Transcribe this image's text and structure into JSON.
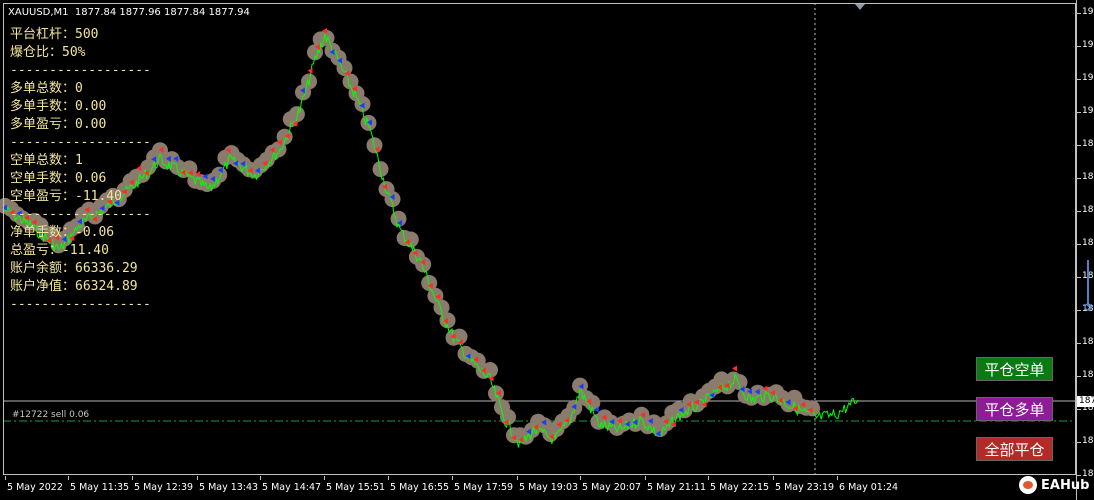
{
  "app": {
    "window_title": "XAUUSD,M1  1877.84 1877.96 1877.84 1877.94"
  },
  "info_panel": {
    "lines": [
      "平台杠杆：500",
      "爆仓比：50%",
      "------------------",
      "多单总数：0",
      "多单手数：0.00",
      "多单盈亏：0.00",
      "------------------",
      "空单总数：1",
      "空单手数：0.06",
      "空单盈亏：-11.40",
      "------------------",
      "净单手数：-0.06",
      "总盈亏：-11.40",
      "账户余额：66336.29",
      "账户净值：66324.89",
      "------------------"
    ]
  },
  "buttons": {
    "close_short": "平仓空单",
    "close_long": "平仓多单",
    "close_all": "全部平仓"
  },
  "order_line": {
    "label": "#12722 sell 0.06",
    "color": "#1e9b3a"
  },
  "current_price_box": "187",
  "x_axis": {
    "labels": [
      "5 May 2022",
      "5 May 11:35",
      "5 May 12:39",
      "5 May 13:43",
      "5 May 14:47",
      "5 May 15:51",
      "5 May 16:55",
      "5 May 17:59",
      "5 May 19:03",
      "5 May 20:07",
      "5 May 21:11",
      "5 May 22:15",
      "5 May 23:19",
      "6 May 01:24"
    ]
  },
  "y_axis": {
    "labels": [
      "19",
      "19",
      "19",
      "19",
      "18",
      "18",
      "18",
      "18",
      "18",
      "18",
      "18",
      "18",
      "18",
      "18",
      "18"
    ]
  },
  "colors": {
    "price_line": "#00ff00",
    "buy_marker": "#1a3cff",
    "sell_marker": "#ff2a2a",
    "marker_halo": "#8a7b6c",
    "text_panel": "#f1e59b",
    "close_short_btn": "#0b7a12",
    "close_long_btn": "#8e1c95",
    "close_all_btn": "#b32b27"
  },
  "logo": {
    "text": "EAHub"
  }
}
